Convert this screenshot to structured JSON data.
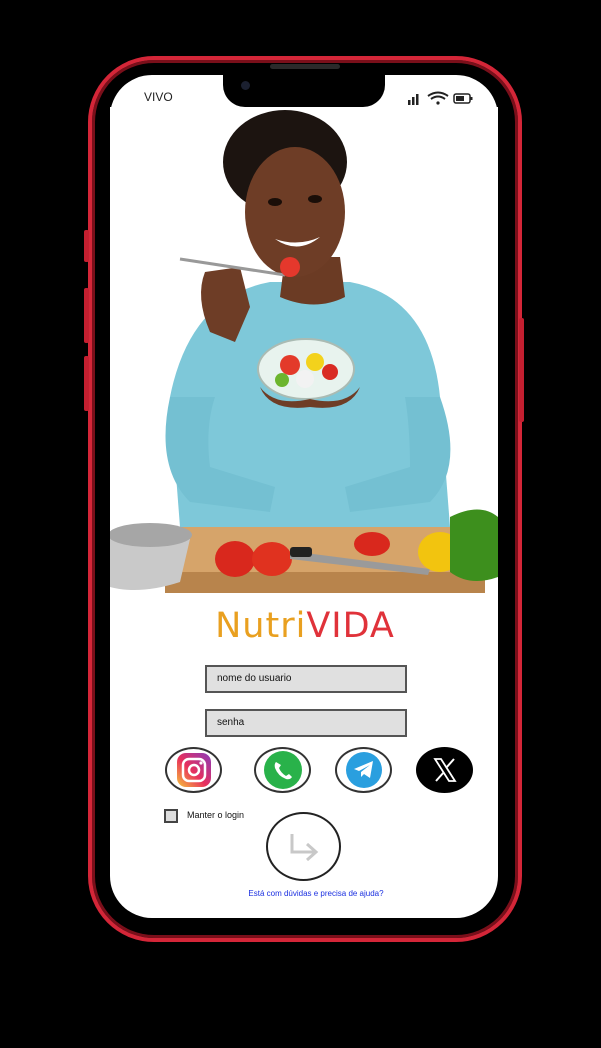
{
  "status_bar": {
    "carrier": "VIVO"
  },
  "brand": {
    "part1": "Nutri",
    "part2": "VIDA"
  },
  "login": {
    "username_placeholder": "nome do usuario",
    "password_placeholder": "senha",
    "remember_label": "Manter o login",
    "help_link": "Está com dúvidas e precisa de ajuda?"
  },
  "social": [
    "instagram-icon",
    "whatsapp-icon",
    "telegram-icon",
    "x-icon"
  ],
  "colors": {
    "frame": "#d42638",
    "brand_orange": "#e9a020",
    "brand_red": "#e0323a",
    "link": "#1a2fe0"
  }
}
